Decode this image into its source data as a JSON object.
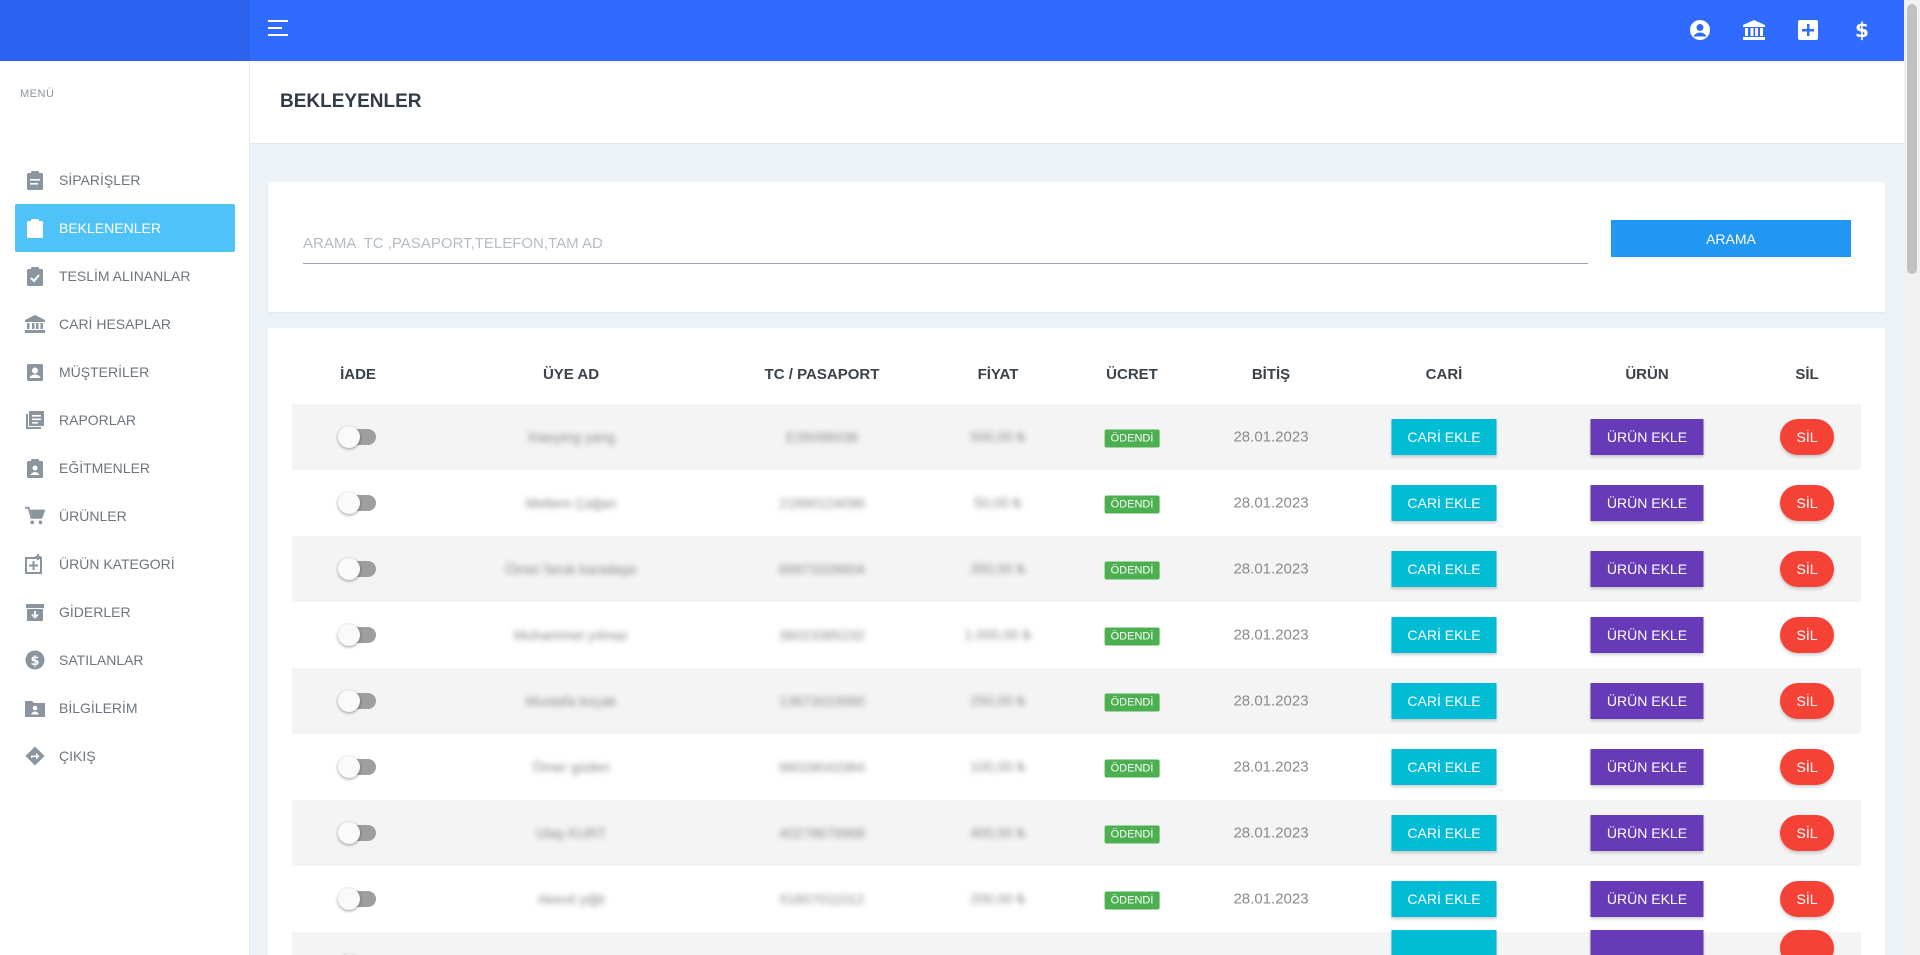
{
  "colors": {
    "topbar": "#2f6bff",
    "sidebar_active": "#4fc3f7",
    "search_button": "#2196f3",
    "cari_button": "#00bcd4",
    "urun_button": "#673ab7",
    "sil_button": "#f44336",
    "paid_badge": "#4caf50"
  },
  "topbar": {
    "icons": [
      "menu-toggle-icon",
      "user-circle-icon",
      "bank-icon",
      "plus-square-icon",
      "dollar-icon"
    ]
  },
  "sidebar": {
    "menu_title": "MENÜ",
    "items": [
      {
        "label": "SİPARİŞLER",
        "icon": "clipboard-icon"
      },
      {
        "label": "BEKLENENLER",
        "icon": "clipboard-download-icon",
        "active": true
      },
      {
        "label": "TESLİM ALINANLAR",
        "icon": "clipboard-check-icon"
      },
      {
        "label": "CARİ HESAPLAR",
        "icon": "bank-icon"
      },
      {
        "label": "MÜŞTERİLER",
        "icon": "contact-card-icon"
      },
      {
        "label": "RAPORLAR",
        "icon": "report-list-icon"
      },
      {
        "label": "EĞİTMENLER",
        "icon": "clipboard-user-icon"
      },
      {
        "label": "ÜRÜNLER",
        "icon": "cart-icon"
      },
      {
        "label": "ÜRÜN KATEGORİ",
        "icon": "category-plus-icon"
      },
      {
        "label": "GİDERLER",
        "icon": "archive-icon"
      },
      {
        "label": "SATILANLAR",
        "icon": "dollar-circle-icon"
      },
      {
        "label": "BİLGİLERİM",
        "icon": "folder-user-icon"
      },
      {
        "label": "ÇIKIŞ",
        "icon": "exit-arrow-icon"
      }
    ]
  },
  "page": {
    "title": "BEKLEYENLER"
  },
  "search": {
    "placeholder": "ARAMA  TC ,PASAPORT,TELEFON,TAM AD",
    "value": "",
    "button_label": "ARAMA"
  },
  "table": {
    "headers": {
      "iade": "İADE",
      "uye_ad": "ÜYE AD",
      "tc": "TC / PASAPORT",
      "fiyat": "FİYAT",
      "ucret": "ÜCRET",
      "bitis": "BİTİŞ",
      "cari": "CARİ",
      "urun": "ÜRÜN",
      "sil": "SİL"
    },
    "rows": [
      {
        "name": "Xiaoying yang",
        "tc": "E26096038",
        "fiyat": "500,00 ₺",
        "ucret": "ÖDENDİ",
        "bitis": "28.01.2023",
        "cari": "CARİ EKLE",
        "urun": "ÜRÜN EKLE",
        "sil": "SİL"
      },
      {
        "name": "Meltem Çağan",
        "tc": "21890124096",
        "fiyat": "50,00 ₺",
        "ucret": "ÖDENDİ",
        "bitis": "28.01.2023",
        "cari": "CARİ EKLE",
        "urun": "ÜRÜN EKLE",
        "sil": "SİL"
      },
      {
        "name": "Ömer faruk karadaşe",
        "tc": "69973328604",
        "fiyat": "350,00 ₺",
        "ucret": "ÖDENDİ",
        "bitis": "28.01.2023",
        "cari": "CARİ EKLE",
        "urun": "ÜRÜN EKLE",
        "sil": "SİL"
      },
      {
        "name": "Muhammet yılmaz",
        "tc": "36023385232",
        "fiyat": "1.000,00 ₺",
        "ucret": "ÖDENDİ",
        "bitis": "28.01.2023",
        "cari": "CARİ EKLE",
        "urun": "ÜRÜN EKLE",
        "sil": "SİL"
      },
      {
        "name": "Mustafa koçak",
        "tc": "13673023990",
        "fiyat": "250,00 ₺",
        "ucret": "ÖDENDİ",
        "bitis": "28.01.2023",
        "cari": "CARİ EKLE",
        "urun": "ÜRÜN EKLE",
        "sil": "SİL"
      },
      {
        "name": "Ömer güden",
        "tc": "66028043364",
        "fiyat": "100,00 ₺",
        "ucret": "ÖDENDİ",
        "bitis": "28.01.2023",
        "cari": "CARİ EKLE",
        "urun": "ÜRÜN EKLE",
        "sil": "SİL"
      },
      {
        "name": "Ulaş KURT",
        "tc": "40278679968",
        "fiyat": "400,00 ₺",
        "ucret": "ÖDENDİ",
        "bitis": "28.01.2023",
        "cari": "CARİ EKLE",
        "urun": "ÜRÜN EKLE",
        "sil": "SİL"
      },
      {
        "name": "Akevit yiğit",
        "tc": "51607011012",
        "fiyat": "200,00 ₺",
        "ucret": "ÖDENDİ",
        "bitis": "28.01.2023",
        "cari": "CARİ EKLE",
        "urun": "ÜRÜN EKLE",
        "sil": "SİL"
      },
      {
        "name": "",
        "tc": "",
        "fiyat": "",
        "ucret": "",
        "bitis": "",
        "cari": "",
        "urun": "",
        "sil": ""
      }
    ]
  }
}
